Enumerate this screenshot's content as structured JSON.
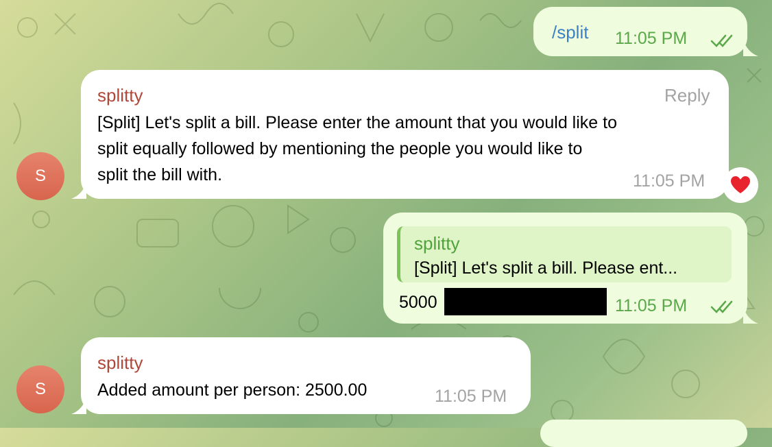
{
  "colors": {
    "incoming_bubble": "#ffffff",
    "outgoing_bubble": "#effdde",
    "sender_name": "#b0483a",
    "command_link": "#3b82c4",
    "read_check": "#5aa84a",
    "avatar": "#d8654e"
  },
  "messages": [
    {
      "direction": "outgoing",
      "text": "/split",
      "time": "11:05 PM",
      "status_icon": "double-check-icon"
    },
    {
      "direction": "incoming",
      "sender": "splitty",
      "avatar_letter": "S",
      "reply_label": "Reply",
      "lines": [
        "[Split] Let's split a bill. Please enter the amount that you would like to",
        "split equally followed by mentioning the people you would like to",
        "split the bill with."
      ],
      "time": "11:05 PM",
      "reaction_icon": "heart-icon"
    },
    {
      "direction": "outgoing",
      "quote": {
        "sender": "splitty",
        "text": "[Split] Let's split a bill. Please ent..."
      },
      "text": "5000",
      "time": "11:05 PM",
      "status_icon": "double-check-icon"
    },
    {
      "direction": "incoming",
      "sender": "splitty",
      "avatar_letter": "S",
      "text": "Added amount per person: 2500.00",
      "time": "11:05 PM"
    }
  ]
}
